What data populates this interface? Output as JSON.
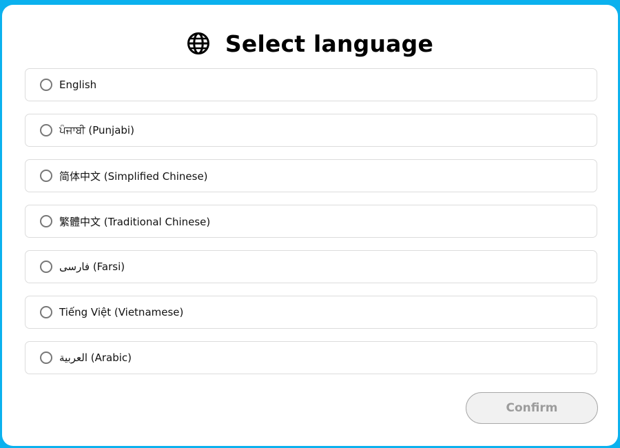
{
  "dialog": {
    "title": "Select language",
    "title_icon": "globe-icon",
    "background_color": "#0bb1ee"
  },
  "languages": [
    {
      "label": "English"
    },
    {
      "label": "ਪੰਜਾਬੀ (Punjabi)"
    },
    {
      "label": "简体中文 (Simplified Chinese)"
    },
    {
      "label": "繁體中文 (Traditional Chinese)"
    },
    {
      "label": "فارسی (Farsi)"
    },
    {
      "label": "Tiếng Việt (Vietnamese)"
    },
    {
      "label": "العربية (Arabic)"
    }
  ],
  "confirm": {
    "label": "Confirm",
    "state": "disabled"
  }
}
